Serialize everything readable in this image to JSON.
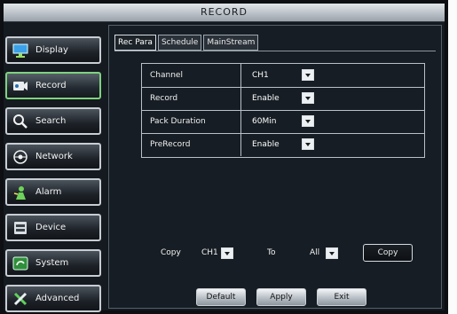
{
  "window": {
    "title": "RECORD"
  },
  "sidebar": {
    "items": [
      {
        "label": "Display",
        "icon": "display-icon",
        "active": false
      },
      {
        "label": "Record",
        "icon": "record-icon",
        "active": true
      },
      {
        "label": "Search",
        "icon": "search-icon",
        "active": false
      },
      {
        "label": "Network",
        "icon": "network-icon",
        "active": false
      },
      {
        "label": "Alarm",
        "icon": "alarm-icon",
        "active": false
      },
      {
        "label": "Device",
        "icon": "device-icon",
        "active": false
      },
      {
        "label": "System",
        "icon": "system-icon",
        "active": false
      },
      {
        "label": "Advanced",
        "icon": "advanced-icon",
        "active": false
      }
    ]
  },
  "tabs": [
    {
      "label": "Rec Para",
      "active": true
    },
    {
      "label": "Schedule",
      "active": false
    },
    {
      "label": "MainStream",
      "active": false
    }
  ],
  "settings": [
    {
      "label": "Channel",
      "value": "CH1"
    },
    {
      "label": "Record",
      "value": "Enable"
    },
    {
      "label": "Pack Duration",
      "value": "60Min"
    },
    {
      "label": "PreRecord",
      "value": "Enable"
    }
  ],
  "copy": {
    "label": "Copy",
    "from_value": "CH1",
    "to_label": "To",
    "to_value": "All",
    "button": "Copy"
  },
  "footer": {
    "default_button": "Default",
    "apply_button": "Apply",
    "exit_button": "Exit"
  },
  "colors": {
    "active_border": "#7fd27f",
    "title_bar": "#c8cdd2",
    "panel_background": "#161d24"
  }
}
